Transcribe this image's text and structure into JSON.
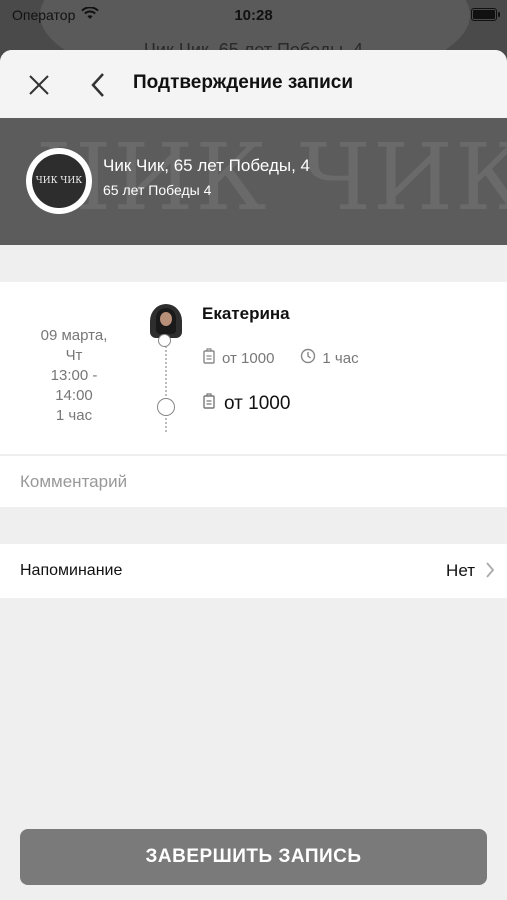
{
  "status_bar": {
    "carrier": "Оператор",
    "time": "10:28"
  },
  "background_title": "Чик Чик, 65 лет Победы, 4",
  "nav": {
    "title": "Подтверждение записи"
  },
  "salon": {
    "watermark": "ЧИК ЧИК",
    "logo_text": "ЧИК ЧИК",
    "name": "Чик Чик, 65 лет Победы, 4",
    "address": "65 лет Победы 4"
  },
  "appointment": {
    "date_line1": "09 марта,",
    "date_line2": "Чт",
    "time_line1": "13:00 -",
    "time_line2": "14:00",
    "duration": "1 час",
    "master_name": "Екатерина",
    "service_price": "от 1000",
    "service_duration": "1 час",
    "total_price": "от 1000"
  },
  "comment": {
    "placeholder": "Комментарий"
  },
  "reminder": {
    "label": "Напоминание",
    "value": "Нет"
  },
  "submit": {
    "label": "ЗАВЕРШИТЬ ЗАПИСЬ"
  },
  "colors": {
    "button": "#7a7a7a",
    "banner": "#5c5c5c",
    "sheet": "#efefef"
  }
}
